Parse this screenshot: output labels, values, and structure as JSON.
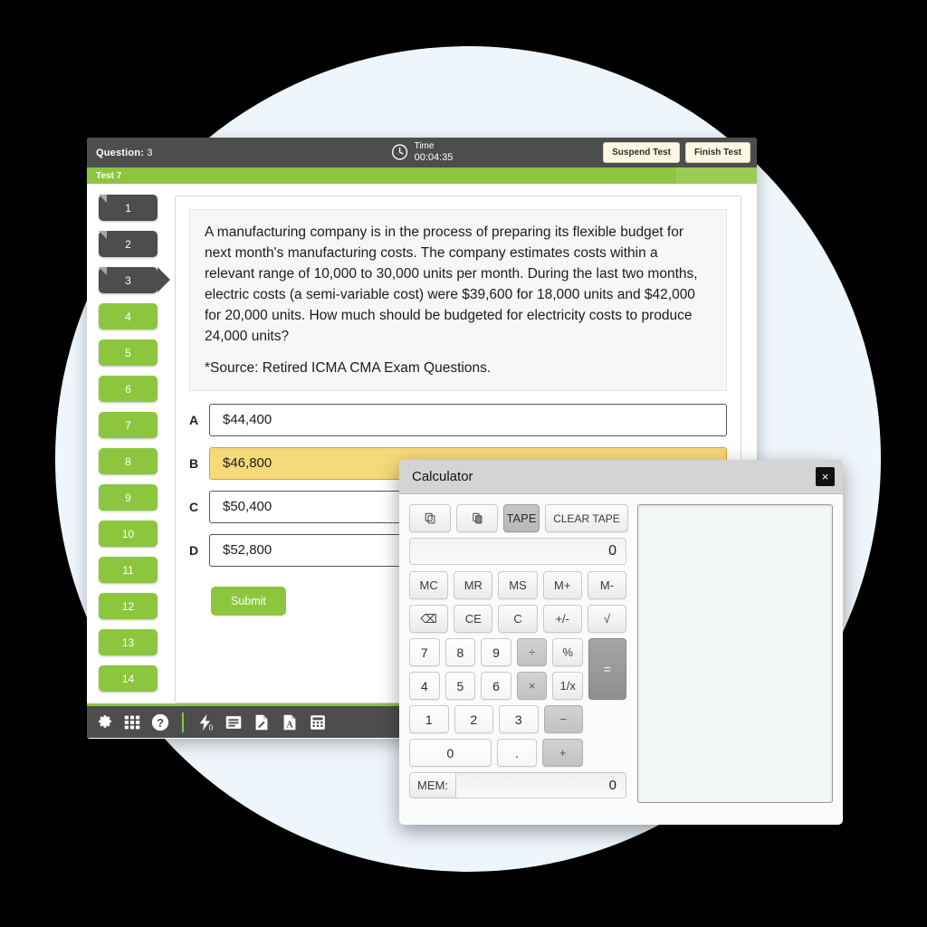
{
  "header": {
    "question_label": "Question:",
    "question_number": "3",
    "time_label": "Time",
    "time_value": "00:04:35",
    "clock_icon": "clock-icon",
    "suspend_label": "Suspend Test",
    "finish_label": "Finish Test"
  },
  "test_bar": {
    "title": "Test 7"
  },
  "question_nav": {
    "items": [
      {
        "number": "1",
        "state": "answered"
      },
      {
        "number": "2",
        "state": "answered"
      },
      {
        "number": "3",
        "state": "current"
      },
      {
        "number": "4",
        "state": "pending"
      },
      {
        "number": "5",
        "state": "pending"
      },
      {
        "number": "6",
        "state": "pending"
      },
      {
        "number": "7",
        "state": "pending"
      },
      {
        "number": "8",
        "state": "pending"
      },
      {
        "number": "9",
        "state": "pending"
      },
      {
        "number": "10",
        "state": "pending"
      },
      {
        "number": "11",
        "state": "pending"
      },
      {
        "number": "12",
        "state": "pending"
      },
      {
        "number": "13",
        "state": "pending"
      },
      {
        "number": "14",
        "state": "pending"
      }
    ]
  },
  "question": {
    "body": "A manufacturing company is in the process of preparing its flexible budget for next month's manufacturing costs. The company estimates costs within a relevant range of 10,000 to 30,000 units per month. During the last two months, electric costs (a semi-variable cost) were $39,600 for 18,000 units and $42,000 for 20,000 units. How much should be budgeted for electricity costs to produce 24,000 units?",
    "source": "*Source: Retired ICMA CMA Exam Questions."
  },
  "answers": {
    "options": [
      {
        "letter": "A",
        "value": "$44,400",
        "selected": false
      },
      {
        "letter": "B",
        "value": "$46,800",
        "selected": true
      },
      {
        "letter": "C",
        "value": "$50,400",
        "selected": false
      },
      {
        "letter": "D",
        "value": "$52,800",
        "selected": false
      }
    ],
    "submit_label": "Submit"
  },
  "bottom_toolbar": {
    "icons": [
      "gear-icon",
      "grid-icon",
      "help-icon",
      "separator",
      "flash-zero-icon",
      "notes-icon",
      "edit-document-icon",
      "pdf-icon",
      "calculator-icon"
    ]
  },
  "calculator": {
    "title": "Calculator",
    "close_label": "×",
    "toolbar": [
      {
        "name": "copy-icon",
        "label": ""
      },
      {
        "name": "paste-icon",
        "label": ""
      },
      {
        "name": "tape-button",
        "label": "TAPE",
        "active": true
      },
      {
        "name": "clear-tape-button",
        "label": "CLEAR TAPE",
        "active": false
      }
    ],
    "display": "0",
    "memory_label": "MEM:",
    "memory_value": "0",
    "tape_content": "",
    "keys": {
      "memory_row": [
        "MC",
        "MR",
        "MS",
        "M+",
        "M-"
      ],
      "clear_row": [
        "⌫",
        "CE",
        "C",
        "+/-",
        "√"
      ],
      "row7": [
        "7",
        "8",
        "9",
        "÷",
        "%"
      ],
      "row4": [
        "4",
        "5",
        "6",
        "×",
        "1/x"
      ],
      "row1": [
        "1",
        "2",
        "3",
        "−"
      ],
      "row0": [
        "0",
        ".",
        "+"
      ],
      "equals": "="
    }
  },
  "colors": {
    "accent_green": "#8cc63e",
    "dark_bar": "#4d4d4d",
    "selected_answer": "#f5d97a",
    "backdrop": "#eef5fb",
    "button_cream": "#fdf7e3"
  }
}
